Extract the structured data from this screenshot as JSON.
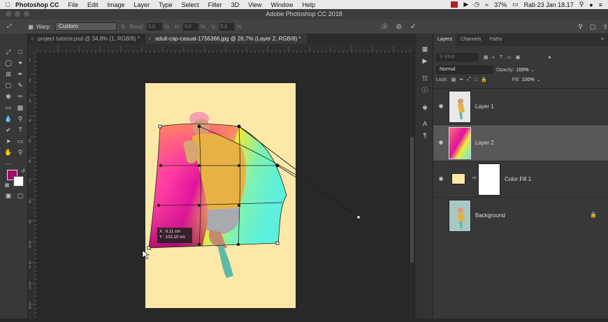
{
  "menubar": {
    "app_name": "Photoshop CC",
    "items": [
      "File",
      "Edit",
      "Image",
      "Layer",
      "Type",
      "Select",
      "Filter",
      "3D",
      "View",
      "Window",
      "Help"
    ],
    "battery": "37%",
    "datetime": "Rab 23 Jan  18.17"
  },
  "window": {
    "title": "Adobe Photoshop CC 2018"
  },
  "options": {
    "warp_label": "Warp:",
    "warp_value": "Custom",
    "bend_label": "Bend:",
    "bend_value": "0,0",
    "h_label": "H:",
    "h_value": "0,0",
    "v_label": "V:",
    "v_value": "0,0",
    "percent": "%"
  },
  "tabs": [
    {
      "label": "project tutorisl.psd @ 34,8% (1, RGB/8) *",
      "active": false
    },
    {
      "label": "adult-cap-casual-1756366.jpg @ 26,7% (Layer 2, RGB/8) *",
      "active": true
    }
  ],
  "transform_info": {
    "x": "X :    6,11 cm",
    "y": "Y : 102,10 cm"
  },
  "ruler_left_labels": [
    "1",
    "2",
    "3",
    "4",
    "5",
    "6",
    "7",
    "8",
    "9",
    "1 0",
    "1 1",
    "1 2",
    "1 3"
  ],
  "layers_panel": {
    "tabs": [
      "Layers",
      "Channels",
      "Paths"
    ],
    "search_placeholder": "Kind",
    "blend_mode": "Normal",
    "opacity_label": "Opacity:",
    "opacity_value": "100%",
    "lock_label": "Lock:",
    "fill_label": "Fill:",
    "fill_value": "100%",
    "layers": [
      {
        "name": "Layer 1",
        "visible": true,
        "selected": false
      },
      {
        "name": "Layer 2",
        "visible": true,
        "selected": true
      },
      {
        "name": "Color Fill 1",
        "visible": true,
        "selected": false
      },
      {
        "name": "Background",
        "visible": false,
        "selected": false,
        "locked": true
      }
    ]
  },
  "colors": {
    "foreground": "#a80c6a",
    "background_swatch": "#ffffff",
    "canvas_bg": "#fce9a8",
    "selected_layer": "#585858"
  }
}
